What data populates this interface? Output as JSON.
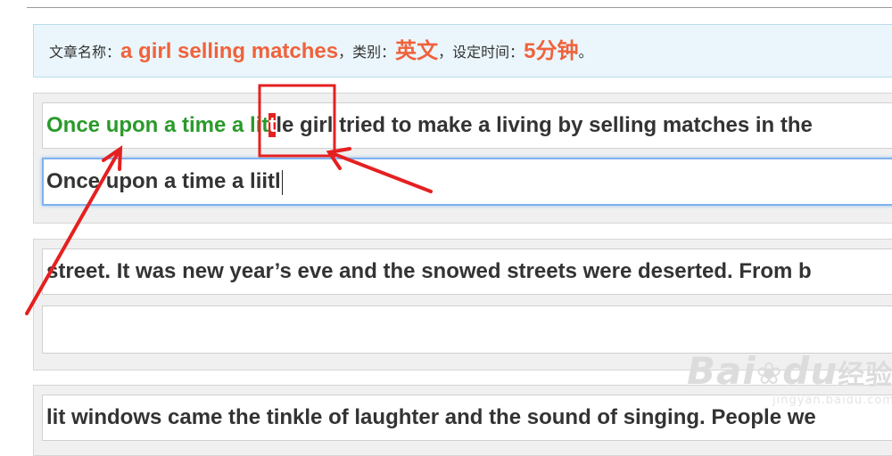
{
  "header": {
    "article_label": "文章名称：",
    "article_title": "a girl selling matches",
    "comma1": "，",
    "category_label": "类别：",
    "category_value": "英文",
    "comma2": "，",
    "time_label": "设定时间：",
    "time_value": "5分钟",
    "period": "。"
  },
  "lines": [
    {
      "typed_correct": "Once upon a time a lit",
      "error_char": "t",
      "remaining": "le girl tried to make a living by selling matches in the",
      "input_value": "Once upon a time a liitl"
    },
    {
      "source": "street. It was new year’s eve and the snowed streets were deserted. From b",
      "input_value": ""
    },
    {
      "source": "lit windows came the tinkle of laughter and the sound of singing. People we"
    }
  ],
  "watermark": {
    "logo": "Bai",
    "logo2": "du",
    "cn": "经验",
    "url": "jingyan.baidu.com"
  },
  "colors": {
    "accent": "#f0623b",
    "typed": "#2a9a2a",
    "error_bg": "#e52020",
    "annotation": "#e52020",
    "info_bg": "#eaf6fc"
  }
}
